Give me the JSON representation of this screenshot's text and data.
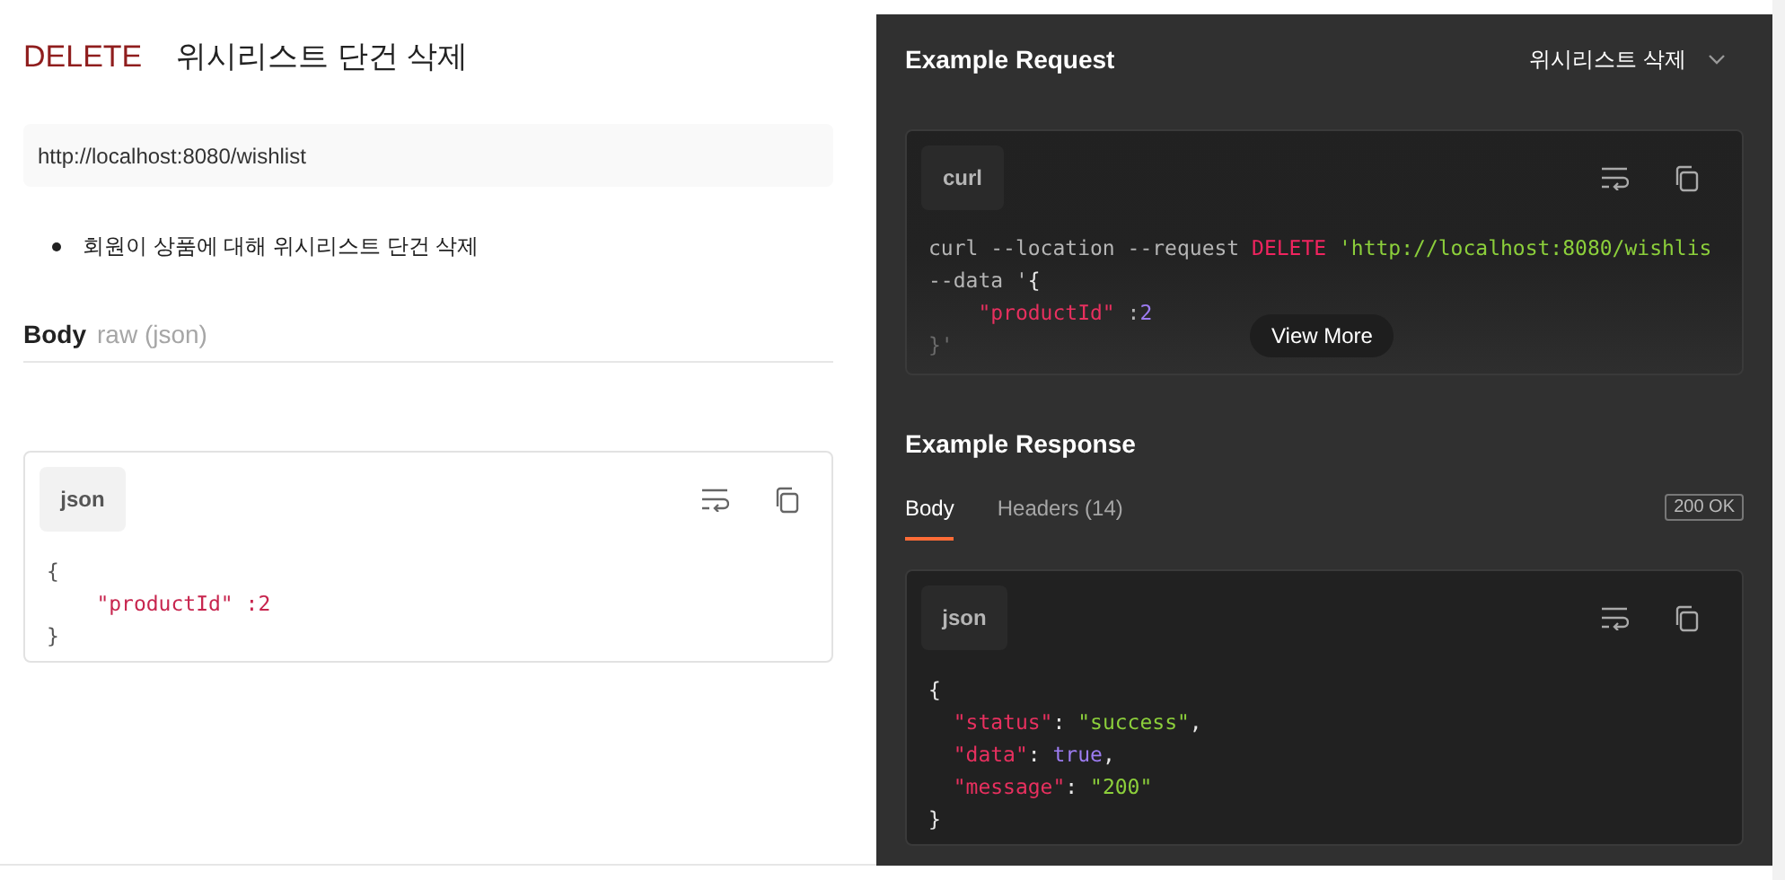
{
  "request": {
    "method": "DELETE",
    "title": "위시리스트 단건 삭제",
    "url": "http://localhost:8080/wishlist",
    "description": [
      "회원이 상품에 대해 위시리스트 단건 삭제"
    ],
    "body": {
      "label": "Body",
      "type": "raw (json)",
      "language": "json",
      "code_lines": [
        [
          {
            "text": "{",
            "kind": "punct"
          }
        ],
        [
          {
            "text": "    \"productId\"",
            "kind": "key"
          },
          {
            "text": " :2",
            "kind": "key"
          }
        ],
        [
          {
            "text": "}",
            "kind": "punct"
          }
        ]
      ]
    }
  },
  "example_request": {
    "title": "Example Request",
    "selector": "위시리스트 삭제",
    "language": "curl",
    "view_more": "View More",
    "code_lines": [
      [
        {
          "text": "curl --location --request ",
          "kind": "plain"
        },
        {
          "text": "DELETE",
          "kind": "keyword"
        },
        {
          "text": " 'http://localhost:8080/wishlis",
          "kind": "string"
        }
      ],
      [
        {
          "text": "--data '",
          "kind": "plain"
        },
        {
          "text": "{",
          "kind": "punct"
        }
      ],
      [
        {
          "text": "    \"productId\"",
          "kind": "key"
        },
        {
          "text": " :",
          "kind": "plain"
        },
        {
          "text": "2",
          "kind": "number"
        }
      ],
      [
        {
          "text": "}'",
          "kind": "dim"
        }
      ]
    ]
  },
  "example_response": {
    "title": "Example Response",
    "tabs": [
      {
        "label": "Body",
        "selected": true
      },
      {
        "label": "Headers (14)",
        "selected": false
      }
    ],
    "status": "200 OK",
    "language": "json",
    "code_lines": [
      [
        {
          "text": "{",
          "kind": "punct"
        }
      ],
      [
        {
          "text": "  \"status\"",
          "kind": "key"
        },
        {
          "text": ": ",
          "kind": "punct"
        },
        {
          "text": "\"success\"",
          "kind": "string"
        },
        {
          "text": ",",
          "kind": "punct"
        }
      ],
      [
        {
          "text": "  \"data\"",
          "kind": "key"
        },
        {
          "text": ": ",
          "kind": "punct"
        },
        {
          "text": "true",
          "kind": "bool"
        },
        {
          "text": ",",
          "kind": "punct"
        }
      ],
      [
        {
          "text": "  \"message\"",
          "kind": "key"
        },
        {
          "text": ": ",
          "kind": "punct"
        },
        {
          "text": "\"200\"",
          "kind": "string"
        }
      ],
      [
        {
          "text": "}",
          "kind": "punct"
        }
      ]
    ]
  }
}
